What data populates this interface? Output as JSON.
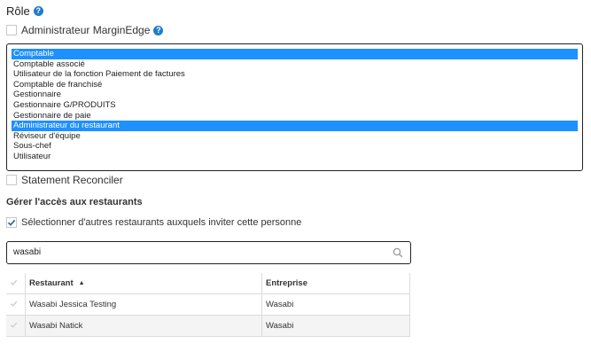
{
  "role": {
    "heading": "Rôle",
    "admin_checkbox_label": "Administrateur MarginEdge",
    "admin_checked": false,
    "options": [
      {
        "label": "Comptable",
        "selected": true
      },
      {
        "label": "Comptable associé",
        "selected": false
      },
      {
        "label": "Utilisateur de la fonction Paiement de factures",
        "selected": false
      },
      {
        "label": "Comptable de franchisé",
        "selected": false
      },
      {
        "label": "Gestionnaire",
        "selected": false
      },
      {
        "label": "Gestionnaire G/PRODUITS",
        "selected": false
      },
      {
        "label": "Gestionnaire de paie",
        "selected": false
      },
      {
        "label": "Administrateur du restaurant",
        "selected": true
      },
      {
        "label": "Réviseur d'équipe",
        "selected": false
      },
      {
        "label": "Sous-chef",
        "selected": false
      },
      {
        "label": "Utilisateur",
        "selected": false
      }
    ],
    "statement_checkbox_label": "Statement Reconciler",
    "statement_checked": false
  },
  "access": {
    "heading": "Gérer l'accès aux restaurants",
    "select_checkbox_label": "Sélectionner d'autres restaurants auxquels inviter cette personne",
    "select_checked": true,
    "search_value": "wasabi"
  },
  "table": {
    "columns": [
      "Restaurant",
      "Entreprise"
    ],
    "rows": [
      {
        "restaurant": "Wasabi Jessica Testing",
        "entreprise": "Wasabi"
      },
      {
        "restaurant": "Wasabi Natick",
        "entreprise": "Wasabi"
      }
    ]
  },
  "colors": {
    "help_icon": "#1f7ccc",
    "selected_option": "#1e90ff",
    "checkmark": "#3a6ea5"
  }
}
